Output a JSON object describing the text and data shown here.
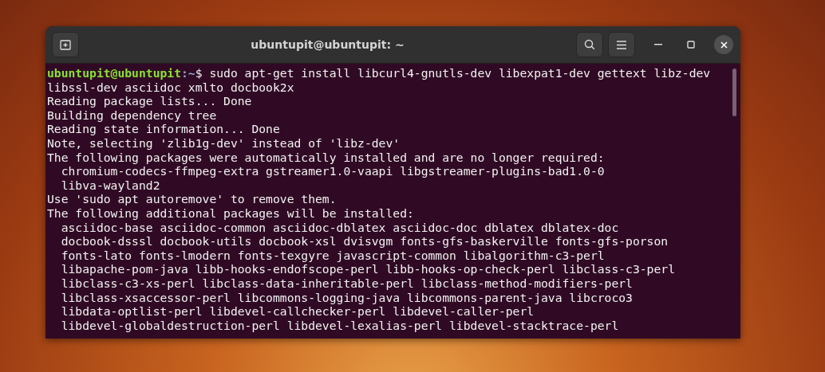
{
  "window": {
    "title": "ubuntupit@ubuntupit: ~"
  },
  "terminal": {
    "lines": [
      {
        "kind": "prompt",
        "user_host": "ubuntupit@ubuntupit",
        "path": ":~",
        "command": "$ sudo apt-get install libcurl4-gnutls-dev libexpat1-dev gettext libz-dev"
      },
      {
        "kind": "output",
        "text": "libssl-dev asciidoc xmlto docbook2x"
      },
      {
        "kind": "output",
        "text": "Reading package lists... Done"
      },
      {
        "kind": "output",
        "text": "Building dependency tree"
      },
      {
        "kind": "output",
        "text": "Reading state information... Done"
      },
      {
        "kind": "output",
        "text": "Note, selecting 'zlib1g-dev' instead of 'libz-dev'"
      },
      {
        "kind": "output",
        "text": "The following packages were automatically installed and are no longer required:"
      },
      {
        "kind": "output",
        "text": "  chromium-codecs-ffmpeg-extra gstreamer1.0-vaapi libgstreamer-plugins-bad1.0-0"
      },
      {
        "kind": "output",
        "text": "  libva-wayland2"
      },
      {
        "kind": "output",
        "text": "Use 'sudo apt autoremove' to remove them."
      },
      {
        "kind": "output",
        "text": "The following additional packages will be installed:"
      },
      {
        "kind": "output",
        "text": "  asciidoc-base asciidoc-common asciidoc-dblatex asciidoc-doc dblatex dblatex-doc"
      },
      {
        "kind": "output",
        "text": "  docbook-dsssl docbook-utils docbook-xsl dvisvgm fonts-gfs-baskerville fonts-gfs-porson"
      },
      {
        "kind": "output",
        "text": "  fonts-lato fonts-lmodern fonts-texgyre javascript-common libalgorithm-c3-perl"
      },
      {
        "kind": "output",
        "text": "  libapache-pom-java libb-hooks-endofscope-perl libb-hooks-op-check-perl libclass-c3-perl"
      },
      {
        "kind": "output",
        "text": "  libclass-c3-xs-perl libclass-data-inheritable-perl libclass-method-modifiers-perl"
      },
      {
        "kind": "output",
        "text": "  libclass-xsaccessor-perl libcommons-logging-java libcommons-parent-java libcroco3"
      },
      {
        "kind": "output",
        "text": "  libdata-optlist-perl libdevel-callchecker-perl libdevel-caller-perl"
      },
      {
        "kind": "output",
        "text": "  libdevel-globaldestruction-perl libdevel-lexalias-perl libdevel-stacktrace-perl"
      }
    ]
  }
}
